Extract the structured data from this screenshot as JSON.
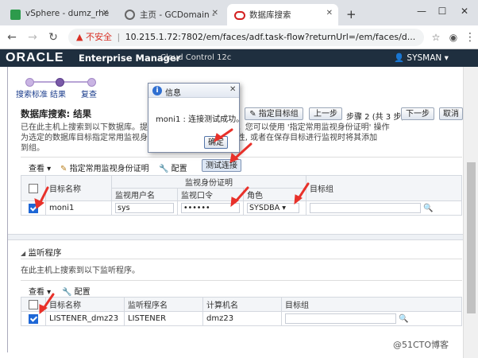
{
  "browser": {
    "tabs": [
      {
        "label": "vSphere - dumz_rhe",
        "active": false
      },
      {
        "label": "主页 - GCDomain -",
        "active": false
      },
      {
        "label": "数据库搜索",
        "active": true
      }
    ],
    "new_tab": "+",
    "security_label": "不安全",
    "url": "10.215.1.72:7802/em/faces/adf.task-flow?returnUrl=/em/faces/d..."
  },
  "em_header": {
    "logo": "ORACLE",
    "product": "Enterprise Manager",
    "edition": "Cloud Control 12c",
    "user": "SYSMAN"
  },
  "train": {
    "steps": [
      "搜索标准",
      "结果",
      "复查"
    ]
  },
  "page": {
    "title": "数据库搜索: 结果",
    "nav": {
      "set_target": "指定目标组",
      "prev": "上一步",
      "step": "步骤 2 (共 3 步)",
      "next": "下一步",
      "cancel": "取消"
    },
    "description_lines": [
      "已在此主机上搜索到以下数据库。提供监...                                    始监视这些数据库。您可以使用 '指定常用监视身份证明' 操作",
      "为选定的数据库目标指定常用监视身份...                              目标设置全局目标属性, 或者在保存目标进行监视时将其添加",
      "到组。"
    ]
  },
  "db_toolbar": {
    "view": "查看",
    "set_creds": "指定常用监视身份证明",
    "configure": "配置",
    "test_conn": "测试连接"
  },
  "db_table": {
    "col_target": "目标名称",
    "col_creds": "监视身份证明",
    "col_user": "监视用户名",
    "col_pass": "监视口令",
    "col_role": "角色",
    "col_group": "目标组",
    "rows": [
      {
        "name": "moni1",
        "user": "sys",
        "password": "••••••",
        "role": "SYSDBA"
      }
    ]
  },
  "listener": {
    "section_title": "监听程序",
    "description": "在此主机上搜索到以下监听程序。",
    "view": "查看",
    "configure": "配置",
    "col_target": "目标名称",
    "col_listener": "监听程序名",
    "col_host": "计算机名",
    "col_group": "目标组",
    "rows": [
      {
        "name": "LISTENER_dmz23",
        "listener": "LISTENER",
        "host": "dmz23"
      }
    ]
  },
  "dialog": {
    "title": "信息",
    "message": "moni1 : 连接测试成功。",
    "ok": "确定"
  },
  "watermark": "@51CTO博客",
  "colors": {
    "header_bg": "#1f2f3f",
    "accent_arrow": "#e8312a",
    "checkbox_on": "#1e67d6"
  }
}
